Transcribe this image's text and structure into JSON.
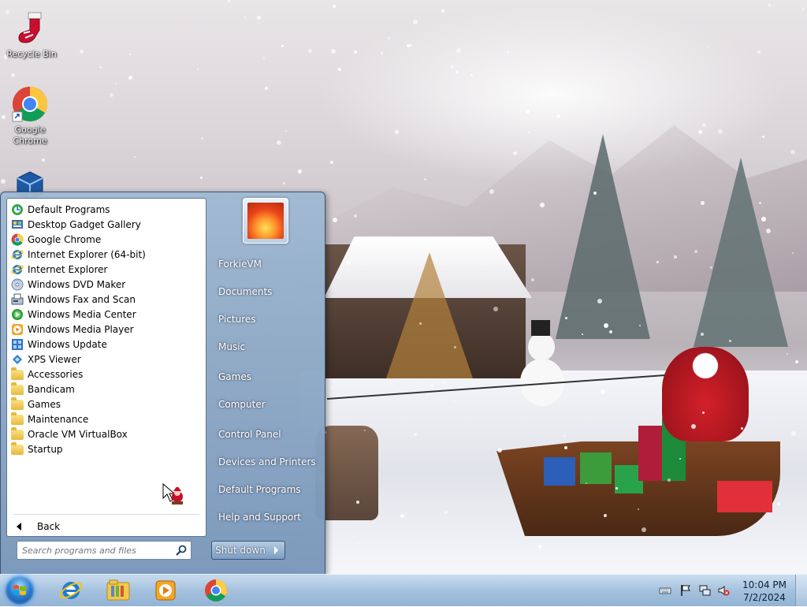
{
  "desktop": {
    "icons": [
      {
        "label": "Recycle Bin",
        "icon": "recycle-bin-stocking-icon"
      },
      {
        "label": "Google\nChrome",
        "icon": "chrome-icon"
      },
      {
        "label": "",
        "icon": "virtualbox-icon"
      }
    ]
  },
  "start_menu": {
    "programs": [
      {
        "label": "Default Programs",
        "icon": "default-programs-icon"
      },
      {
        "label": "Desktop Gadget Gallery",
        "icon": "gadget-gallery-icon"
      },
      {
        "label": "Google Chrome",
        "icon": "chrome-icon"
      },
      {
        "label": "Internet Explorer (64-bit)",
        "icon": "ie-icon"
      },
      {
        "label": "Internet Explorer",
        "icon": "ie-icon"
      },
      {
        "label": "Windows DVD Maker",
        "icon": "dvd-maker-icon"
      },
      {
        "label": "Windows Fax and Scan",
        "icon": "fax-scan-icon"
      },
      {
        "label": "Windows Media Center",
        "icon": "media-center-icon"
      },
      {
        "label": "Windows Media Player",
        "icon": "media-player-icon"
      },
      {
        "label": "Windows Update",
        "icon": "windows-update-icon"
      },
      {
        "label": "XPS Viewer",
        "icon": "xps-viewer-icon"
      },
      {
        "label": "Accessories",
        "icon": "folder-icon"
      },
      {
        "label": "Bandicam",
        "icon": "folder-icon"
      },
      {
        "label": "Games",
        "icon": "folder-icon"
      },
      {
        "label": "Maintenance",
        "icon": "folder-icon"
      },
      {
        "label": "Oracle VM VirtualBox",
        "icon": "folder-icon"
      },
      {
        "label": "Startup",
        "icon": "folder-icon"
      }
    ],
    "back_label": "Back",
    "search_placeholder": "Search programs and files",
    "user_picture": "flower-user-picture",
    "right_links": [
      {
        "label": "ForkieVM"
      },
      {
        "label": "Documents"
      },
      {
        "label": "Pictures"
      },
      {
        "label": "Music"
      },
      {
        "label": "Games"
      },
      {
        "label": "Computer"
      },
      {
        "label": "Control Panel"
      },
      {
        "label": "Devices and Printers"
      },
      {
        "label": "Default Programs"
      },
      {
        "label": "Help and Support"
      }
    ],
    "shutdown_label": "Shut down"
  },
  "taskbar": {
    "pinned": [
      {
        "name": "internet-explorer",
        "icon": "ie-icon"
      },
      {
        "name": "windows-explorer",
        "icon": "folder-library-icon"
      },
      {
        "name": "media-player",
        "icon": "media-player-icon"
      },
      {
        "name": "google-chrome",
        "icon": "chrome-icon"
      }
    ],
    "tray_icons": [
      "keyboard-icon",
      "action-center-flag-icon",
      "network-icon",
      "volume-muted-icon"
    ],
    "clock": {
      "time": "10:04 PM",
      "date": "7/2/2024"
    }
  },
  "colors": {
    "taskbar": "#a9c3df",
    "start_orb": "#2a7bd0",
    "menu_frame": "#7c9dc3"
  }
}
